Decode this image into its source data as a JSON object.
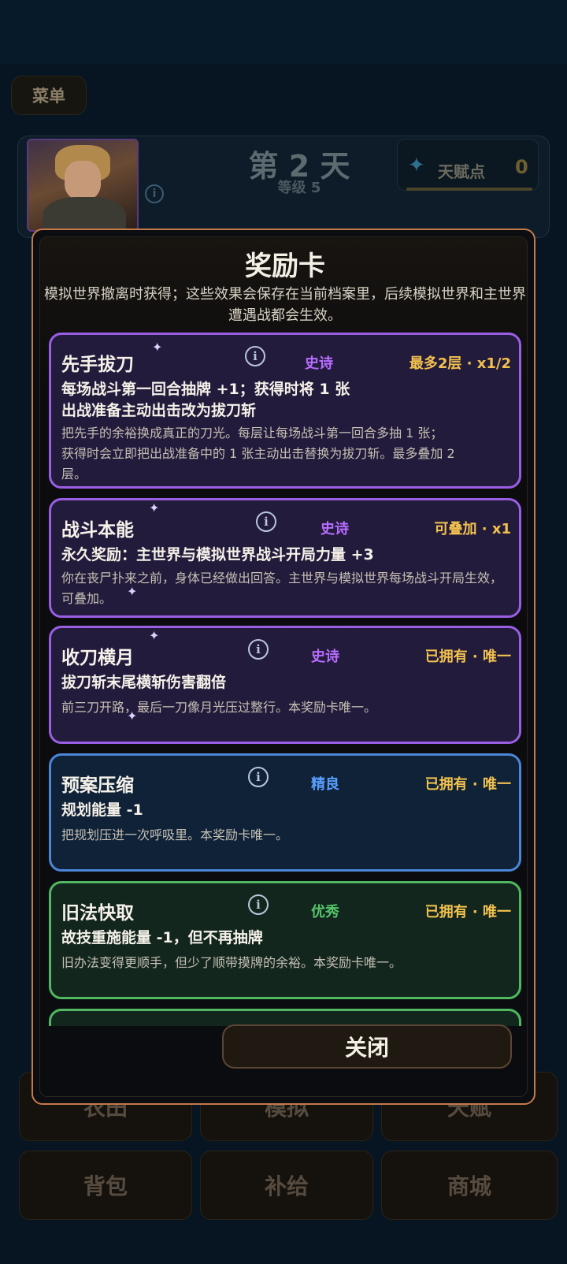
{
  "background": {
    "menu_label": "菜单",
    "day_title": "第 2 天",
    "level_text": "等级 5",
    "talent_label": "天赋点",
    "talent_value": "0",
    "nav": [
      "农田",
      "模拟",
      "天赋",
      "背包",
      "补给",
      "商城"
    ]
  },
  "modal": {
    "title": "奖励卡",
    "description": "模拟世界撤离时获得；这些效果会保存在当前档案里，后续模拟世界和主世界遭遇战都会生效。",
    "close_label": "关闭",
    "cards": [
      {
        "name": "先手拔刀",
        "rarity": "史诗",
        "stack": "最多2层 · x1/2",
        "effect": "每场战斗第一回合抽牌 +1；获得时将 1 张出战准备主动出击改为拔刀斩",
        "flavor": "把先手的余裕换成真正的刀光。每层让每场战斗第一回合多抽 1 张；获得时会立即把出战准备中的 1 张主动出击替换为拔刀斩。最多叠加 2 层。"
      },
      {
        "name": "战斗本能",
        "rarity": "史诗",
        "stack": "可叠加 · x1",
        "effect": "永久奖励：主世界与模拟世界战斗开局力量 +3",
        "flavor": "你在丧尸扑来之前，身体已经做出回答。主世界与模拟世界每场战斗开局生效，可叠加。"
      },
      {
        "name": "收刀横月",
        "rarity": "史诗",
        "stack": "已拥有 · 唯一",
        "effect": "拔刀斩末尾横斩伤害翻倍",
        "flavor": "前三刀开路，最后一刀像月光压过整行。本奖励卡唯一。"
      },
      {
        "name": "预案压缩",
        "rarity": "精良",
        "stack": "已拥有 · 唯一",
        "effect": "规划能量 -1",
        "flavor": "把规划压进一次呼吸里。本奖励卡唯一。"
      },
      {
        "name": "旧法快取",
        "rarity": "优秀",
        "stack": "已拥有 · 唯一",
        "effect": "故技重施能量 -1，但不再抽牌",
        "flavor": "旧办法变得更顺手，但少了顺带摸牌的余裕。本奖励卡唯一。"
      }
    ]
  }
}
